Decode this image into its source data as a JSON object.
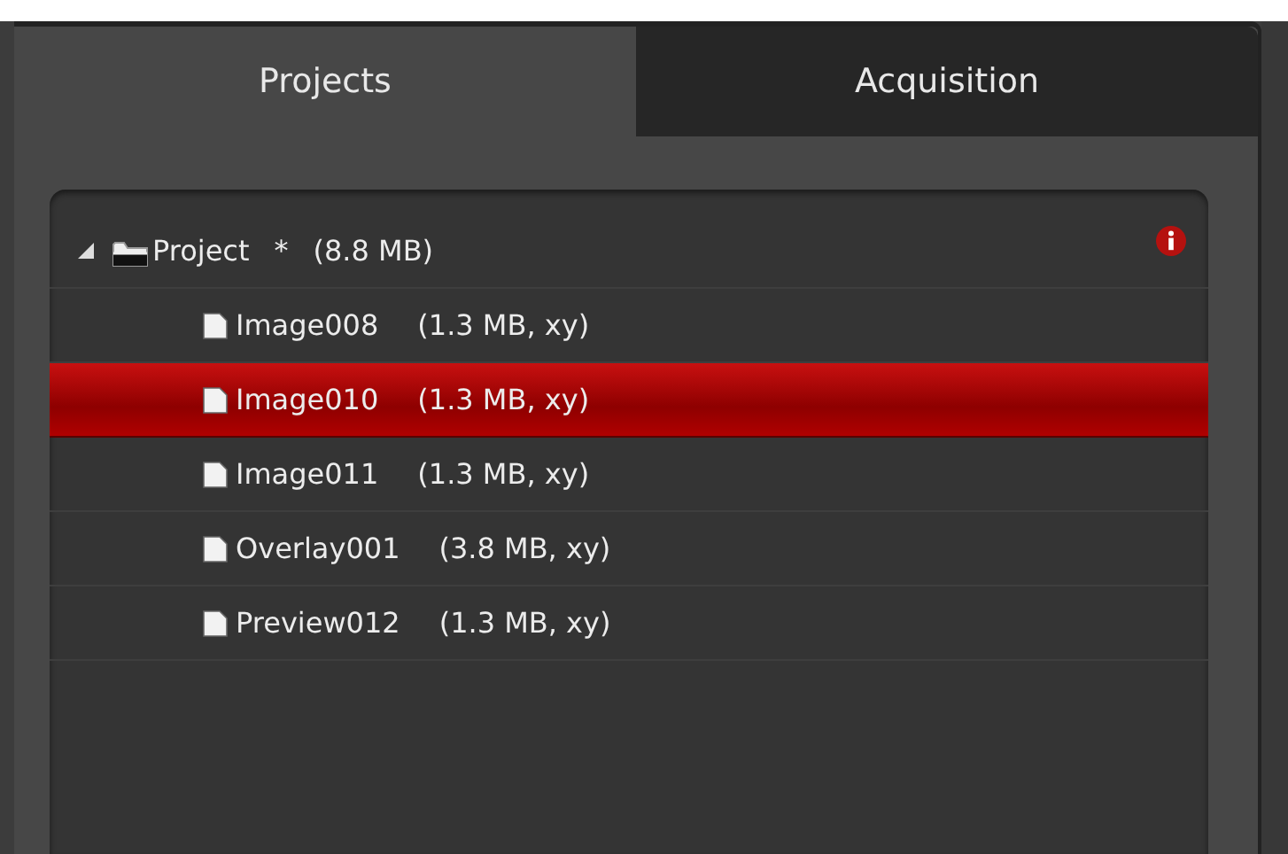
{
  "tabs": [
    {
      "label": "Projects",
      "selected": true
    },
    {
      "label": "Acquisition",
      "selected": false
    }
  ],
  "tree": {
    "root": {
      "name": "Project",
      "modified": "*",
      "size": "(8.8 MB)",
      "expanded": true,
      "info": true,
      "children": [
        {
          "name": "Image008",
          "size": "(1.3 MB, xy)",
          "selected": false
        },
        {
          "name": "Image010",
          "size": "(1.3 MB, xy)",
          "selected": true
        },
        {
          "name": "Image011",
          "size": "(1.3 MB, xy)",
          "selected": false
        },
        {
          "name": "Overlay001",
          "size": "(3.8 MB, xy)",
          "selected": false
        },
        {
          "name": "Preview012",
          "size": "(1.3 MB, xy)",
          "selected": false
        }
      ]
    }
  }
}
